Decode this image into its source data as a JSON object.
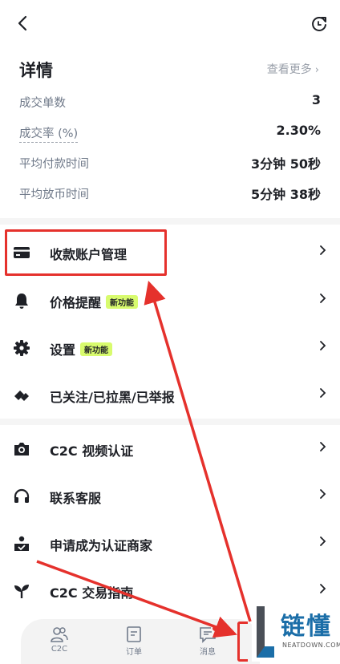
{
  "header": {
    "back_icon": "chevron-left-icon",
    "refresh_icon": "refresh-icon"
  },
  "details": {
    "title": "详情",
    "more": "查看更多",
    "stats": [
      {
        "label": "成交单数",
        "value": "3"
      },
      {
        "label": "成交率 (%)",
        "value": "2.30%"
      },
      {
        "label": "平均付款时间",
        "value": "3分钟 50秒"
      },
      {
        "label": "平均放币时间",
        "value": "5分钟 38秒"
      }
    ]
  },
  "menu_group_1": [
    {
      "label": "收款账户管理",
      "icon": "card-icon"
    },
    {
      "label": "价格提醒",
      "icon": "bell-icon",
      "badge": "新功能"
    },
    {
      "label": "设置",
      "icon": "gear-icon",
      "badge": "新功能"
    },
    {
      "label": "已关注/已拉黑/已举报",
      "icon": "tag-icon"
    }
  ],
  "menu_group_2": [
    {
      "label": "C2C 视频认证",
      "icon": "camera-icon"
    },
    {
      "label": "联系客服",
      "icon": "headphones-icon"
    },
    {
      "label": "申请成为认证商家",
      "icon": "merchant-icon"
    },
    {
      "label": "C2C 交易指南",
      "icon": "sprout-icon"
    }
  ],
  "tabbar": [
    {
      "label": "C2C",
      "icon": "users-icon"
    },
    {
      "label": "订单",
      "icon": "document-icon"
    },
    {
      "label": "消息",
      "icon": "message-icon"
    }
  ],
  "watermark": {
    "title": "链懂",
    "subtitle": "NEATDOWN.COM"
  },
  "colors": {
    "highlight": "#e5312c",
    "badge": "#d8fb6e",
    "brand_blue": "#1b6ea8"
  }
}
